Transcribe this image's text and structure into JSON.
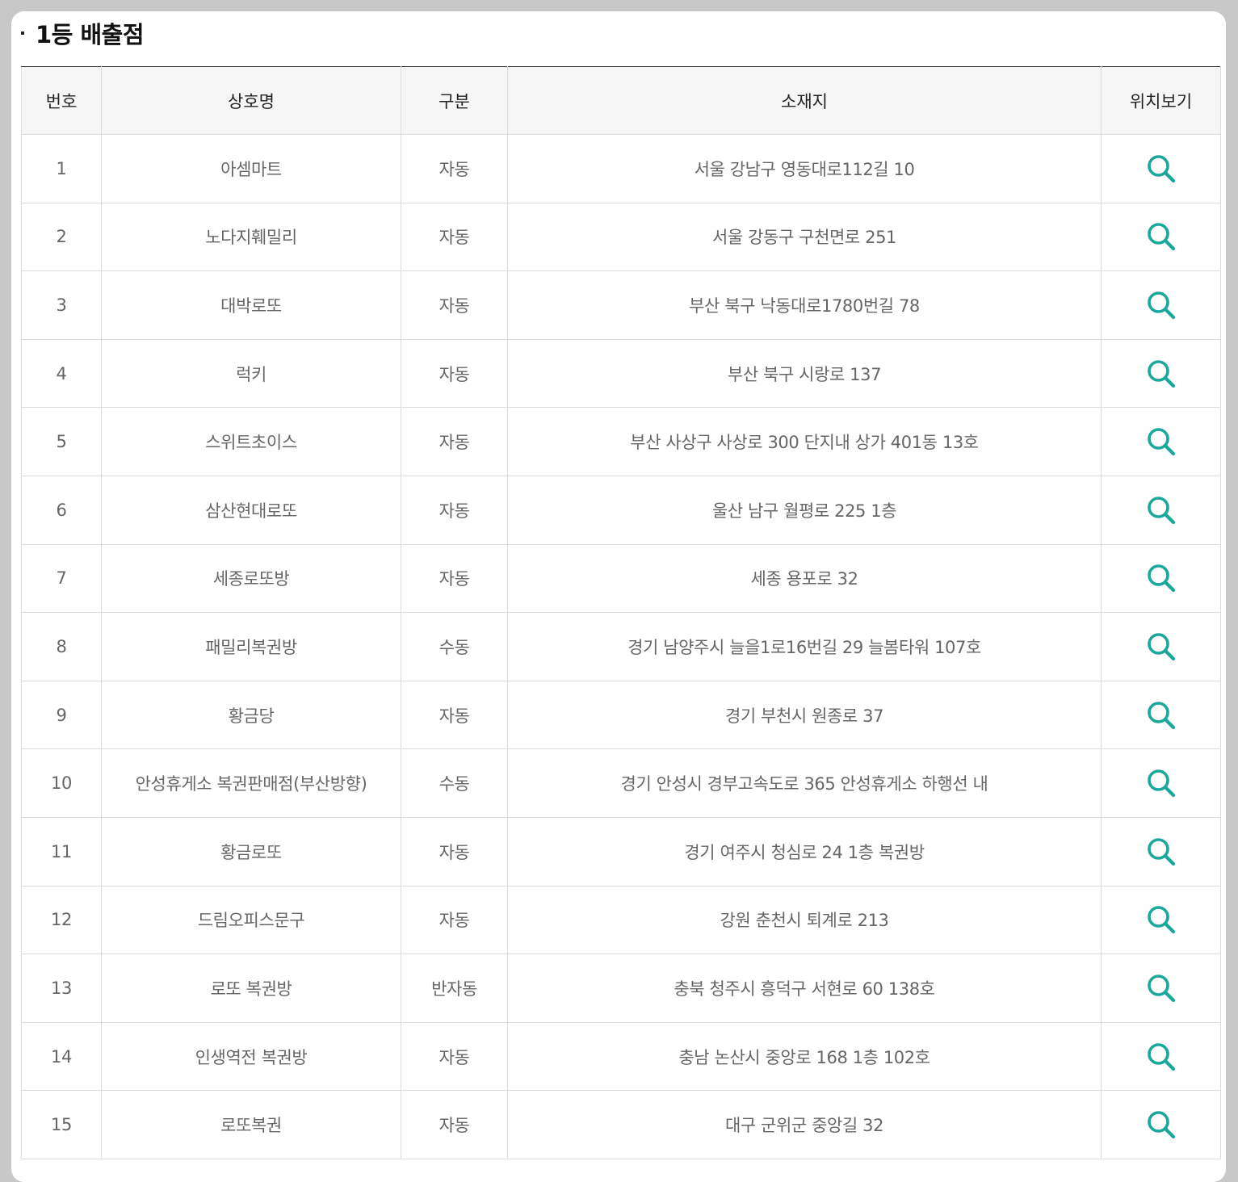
{
  "section": {
    "title": "1등 배출점"
  },
  "table": {
    "headers": {
      "no": "번호",
      "name": "상호명",
      "type": "구분",
      "address": "소재지",
      "location": "위치보기"
    },
    "rows": [
      {
        "no": "1",
        "name": "아셈마트",
        "type": "자동",
        "address": "서울 강남구 영동대로112길 10"
      },
      {
        "no": "2",
        "name": "노다지훼밀리",
        "type": "자동",
        "address": "서울 강동구 구천면로 251"
      },
      {
        "no": "3",
        "name": "대박로또",
        "type": "자동",
        "address": "부산 북구 낙동대로1780번길 78"
      },
      {
        "no": "4",
        "name": "럭키",
        "type": "자동",
        "address": "부산 북구 시랑로 137"
      },
      {
        "no": "5",
        "name": "스위트초이스",
        "type": "자동",
        "address": "부산 사상구 사상로 300 단지내 상가 401동 13호"
      },
      {
        "no": "6",
        "name": "삼산현대로또",
        "type": "자동",
        "address": "울산 남구 월평로 225 1층"
      },
      {
        "no": "7",
        "name": "세종로또방",
        "type": "자동",
        "address": "세종 용포로 32"
      },
      {
        "no": "8",
        "name": "패밀리복권방",
        "type": "수동",
        "address": "경기 남양주시 늘을1로16번길 29 늘봄타워 107호"
      },
      {
        "no": "9",
        "name": "황금당",
        "type": "자동",
        "address": "경기 부천시 원종로 37"
      },
      {
        "no": "10",
        "name": "안성휴게소 복권판매점(부산방향)",
        "type": "수동",
        "address": "경기 안성시 경부고속도로 365 안성휴게소 하행선 내"
      },
      {
        "no": "11",
        "name": "황금로또",
        "type": "자동",
        "address": "경기 여주시 청심로 24 1층 복권방"
      },
      {
        "no": "12",
        "name": "드림오피스문구",
        "type": "자동",
        "address": "강원 춘천시 퇴계로 213"
      },
      {
        "no": "13",
        "name": "로또 복권방",
        "type": "반자동",
        "address": "충북 청주시 흥덕구 서현로 60 138호"
      },
      {
        "no": "14",
        "name": "인생역전 복권방",
        "type": "자동",
        "address": "충남 논산시 중앙로 168 1층 102호"
      },
      {
        "no": "15",
        "name": "로또복권",
        "type": "자동",
        "address": "대구 군위군 중앙길 32"
      }
    ]
  },
  "icons": {
    "search": "search-icon",
    "accent_color": "#1aa79c"
  }
}
